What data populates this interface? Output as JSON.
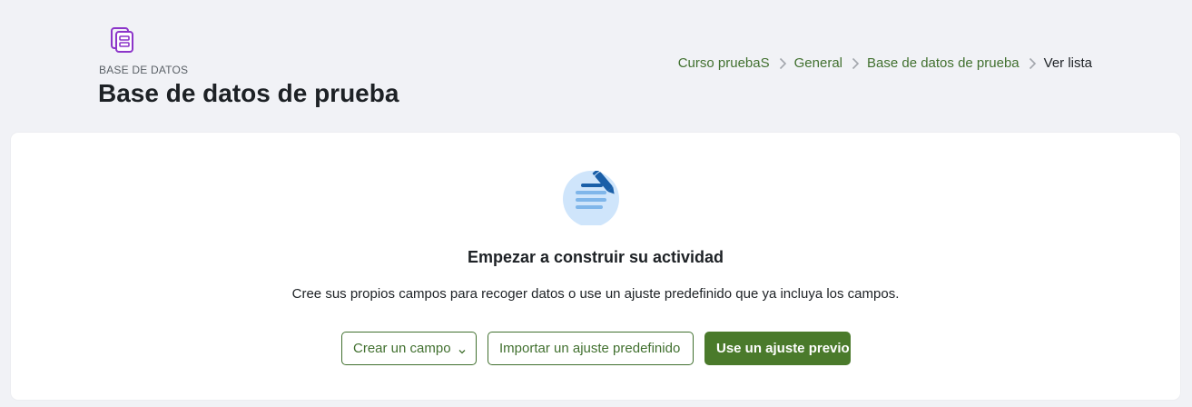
{
  "header": {
    "activity_type": "BASE DE DATOS",
    "title": "Base de datos de prueba",
    "icon": "database-activity-icon"
  },
  "breadcrumb": {
    "items": [
      "Curso pruebaS",
      "General",
      "Base de datos de prueba",
      "Ver lista"
    ]
  },
  "empty_state": {
    "illustration": "edit-document-icon",
    "heading": "Empezar a construir su actividad",
    "description": "Cree sus propios campos para recoger datos o use un ajuste predefinido que ya incluya los campos."
  },
  "actions": {
    "create_field_label": "Crear un campo",
    "import_preset_label": "Importar un ajuste predefinido",
    "use_preset_label": "Use un ajuste previo"
  },
  "colors": {
    "accent_green": "#41702f",
    "primary_button": "#4a7a2b",
    "activity_icon_purple": "#8c35c9",
    "illustration_blue": "#1a5fa8",
    "illustration_light": "#cfe5fb",
    "background": "#f1f2f6"
  }
}
